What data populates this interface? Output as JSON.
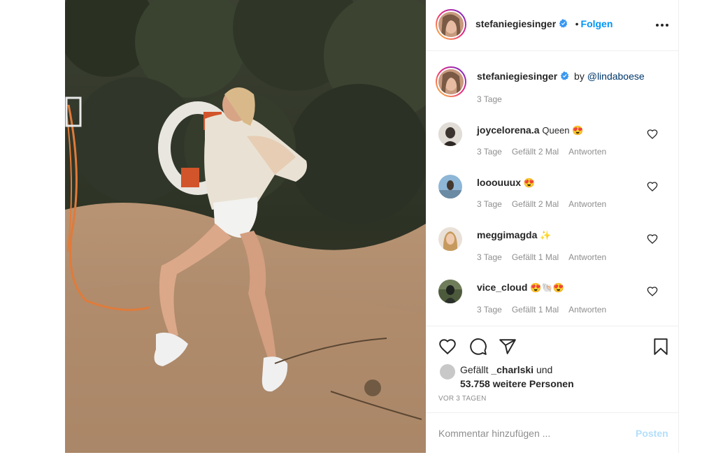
{
  "post": {
    "author": "stefaniegiesinger",
    "follow_separator": "•",
    "follow_label": "Folgen",
    "photo_alt": "Frau im Strandoutfit mit Rettungsring"
  },
  "caption": {
    "author": "stefaniegiesinger",
    "text": "by",
    "mention": "@lindaboese",
    "time": "3 Tage"
  },
  "comments": [
    {
      "user": "joycelorena.a",
      "text": "Queen 😍",
      "time": "3 Tage",
      "likes": "Gefällt 2 Mal",
      "reply": "Antworten"
    },
    {
      "user": "looouuux",
      "text": "😍",
      "time": "3 Tage",
      "likes": "Gefällt 2 Mal",
      "reply": "Antworten"
    },
    {
      "user": "meggimagda",
      "text": "✨",
      "time": "3 Tage",
      "likes": "Gefällt 1 Mal",
      "reply": "Antworten"
    },
    {
      "user": "vice_cloud",
      "text": "😍🐚😍",
      "time": "3 Tage",
      "likes": "Gefällt 1 Mal",
      "reply": "Antworten"
    }
  ],
  "likes": {
    "prefix": "Gefällt",
    "user": "_charlski",
    "connector": "und",
    "count": "53.758 weitere Personen"
  },
  "timestamp": "VOR 3 TAGEN",
  "add_comment": {
    "placeholder": "Kommentar hinzufügen ...",
    "post_label": "Posten"
  },
  "icons": {
    "verified": "verified-badge-icon",
    "more": "more-options-icon",
    "like": "heart-icon",
    "comment": "comment-icon",
    "share": "share-icon",
    "save": "bookmark-icon"
  },
  "colors": {
    "accent": "#0095f6",
    "text": "#262626",
    "muted": "#8e8e8e",
    "border": "#efefef"
  }
}
